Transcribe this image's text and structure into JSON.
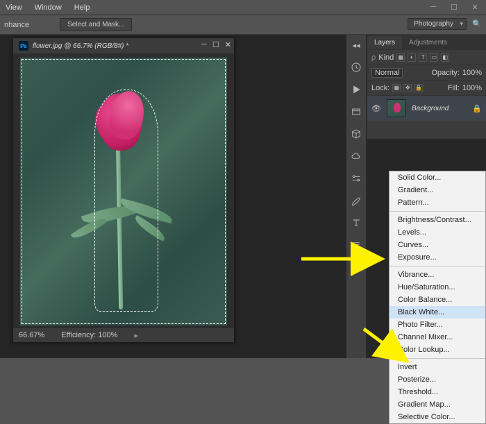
{
  "menubar": {
    "view": "View",
    "window": "Window",
    "help": "Help"
  },
  "toolbar": {
    "enhance": "nhance",
    "select_and_mask": "Select and Mask..."
  },
  "workspace": {
    "selected": "Photography"
  },
  "document": {
    "tab_title": "flower.jpg @ 66.7% (RGB/8#) *",
    "zoom": "66.67%",
    "efficiency": "Efficiency: 100%"
  },
  "layers_panel": {
    "tab_layers": "Layers",
    "tab_adjustments": "Adjustments",
    "filter_placeholder": "Kind",
    "blend_mode": "Normal",
    "opacity_label": "Opacity:",
    "opacity_value": "100%",
    "lock_label": "Lock:",
    "fill_label": "Fill:",
    "fill_value": "100%",
    "layer_name": "Background"
  },
  "menu": {
    "items": [
      "Solid Color...",
      "Gradient...",
      "Pattern...",
      "",
      "Brightness/Contrast...",
      "Levels...",
      "Curves...",
      "Exposure...",
      "",
      "Vibrance...",
      "Hue/Saturation...",
      "Color Balance...",
      "Black  White...",
      "Photo Filter...",
      "Channel Mixer...",
      "Color Lookup...",
      "",
      "Invert",
      "Posterize...",
      "Threshold...",
      "Gradient Map...",
      "Selective Color..."
    ],
    "highlighted": "Black  White..."
  }
}
